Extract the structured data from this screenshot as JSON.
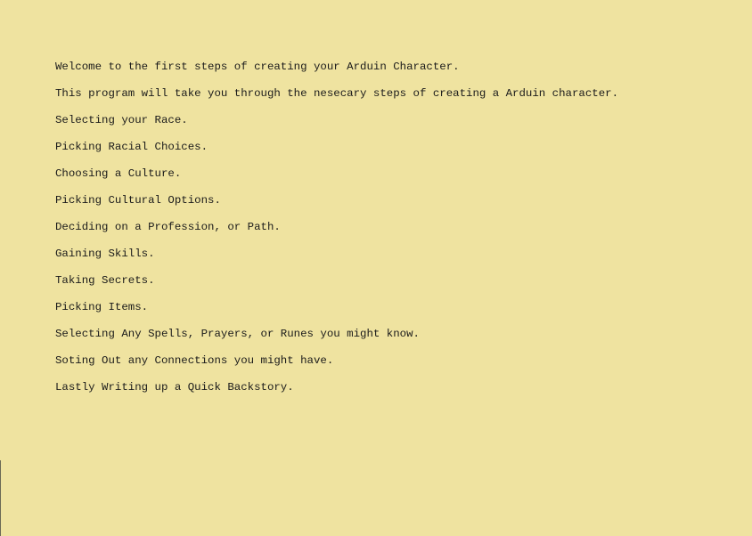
{
  "intro": {
    "welcome": "Welcome to the first steps of creating your Arduin Character.",
    "description": "This program will take you through the nesecary steps of creating a Arduin character."
  },
  "steps": [
    "Selecting your Race.",
    "Picking Racial Choices.",
    "Choosing a Culture.",
    "Picking Cultural Options.",
    "Deciding on a Profession, or Path.",
    "Gaining Skills.",
    "Taking Secrets.",
    "Picking Items.",
    "Selecting Any Spells, Prayers, or Runes you might know.",
    "Soting Out any Connections you might have.",
    "Lastly Writing up a Quick Backstory."
  ]
}
